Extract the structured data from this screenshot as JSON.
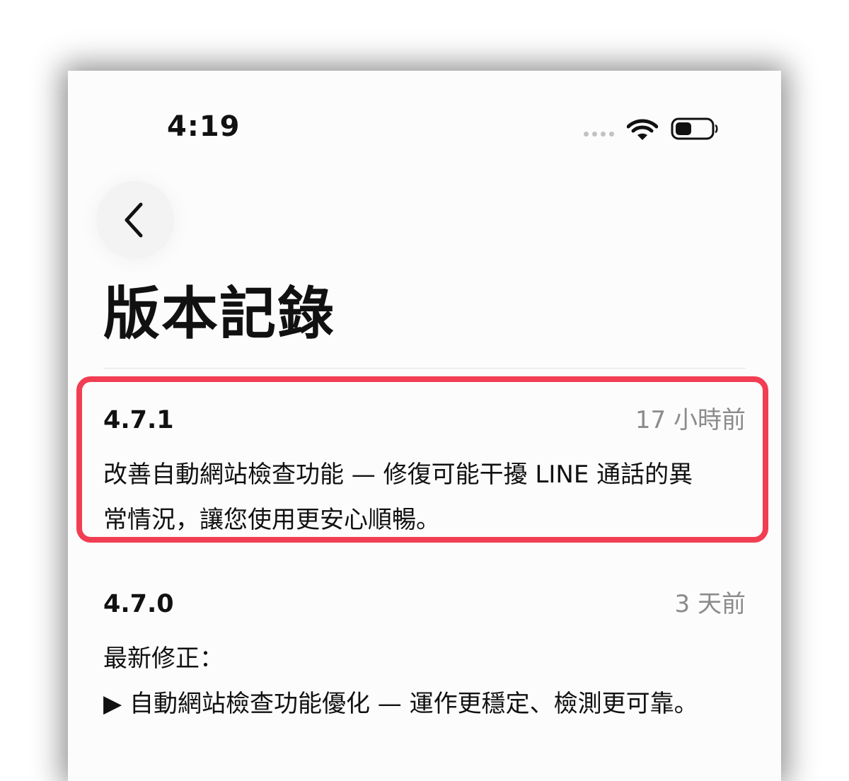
{
  "status_bar": {
    "time": "4:19",
    "icons": [
      "signal-icon",
      "wifi-icon",
      "battery-icon"
    ]
  },
  "nav": {
    "back_icon": "chevron-left-icon"
  },
  "page": {
    "title": "版本記錄"
  },
  "releases": [
    {
      "version": "4.7.1",
      "age": "17 小時前",
      "lines": [
        "改善自動網站檢查功能 — 修復可能干擾 LINE 通話的異",
        "常情況，讓您使用更安心順暢。"
      ],
      "highlighted": true
    },
    {
      "version": "4.7.0",
      "age": "3 天前",
      "lines": [
        "最新修正：",
        "▶ 自動網站檢查功能優化 — 運作更穩定、檢測更可靠。"
      ],
      "highlighted": false
    }
  ],
  "colors": {
    "highlight_border": "#f13e52",
    "text_primary": "#111111",
    "text_secondary": "#8b8b8b",
    "screen_background": "#fcfcfc"
  }
}
